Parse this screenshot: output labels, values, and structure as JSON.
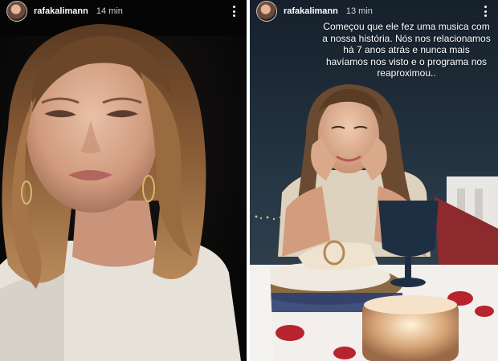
{
  "stories": [
    {
      "username": "rafakalimann",
      "time": "14 min"
    },
    {
      "username": "rafakalimann",
      "time": "13 min",
      "caption": "Começou que ele fez uma musica com a nossa história. Nós nos relacionamos há 7 anos atrás e nunca mais havíamos nos visto e o programa nos reaproximou.."
    }
  ],
  "colors": {
    "left_background": "#0b0b0b",
    "right_background": "#1d2a36",
    "header_text": "#ffffff"
  },
  "icons": {
    "avatar": "profile-avatar",
    "more": "vertical-ellipsis-icon"
  }
}
